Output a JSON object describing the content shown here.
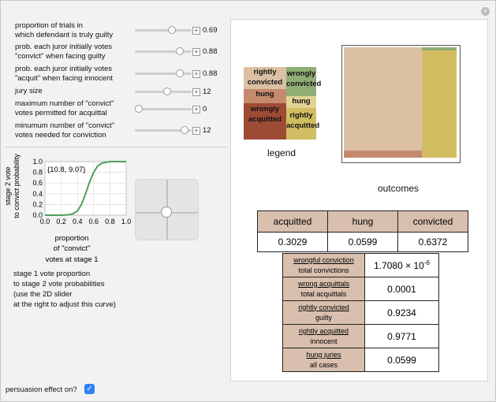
{
  "controls": [
    {
      "label_line1": "proportion of trials in",
      "label_line2": "which defendant is truly guilty",
      "value": "0.69",
      "fraction": 0.69
    },
    {
      "label_line1": "prob. each juror initially votes",
      "label_line2": "\"convict\" when facing guilty",
      "value": "0.88",
      "fraction": 0.88
    },
    {
      "label_line1": "prob. each juror initially votes",
      "label_line2": "\"acquit\" when facing innocent",
      "value": "0.88",
      "fraction": 0.88
    },
    {
      "label_line1": "jury size",
      "label_line2": "",
      "value": "12",
      "fraction": 0.55
    },
    {
      "label_line1": "maximum number of \"convict\"",
      "label_line2": "votes permitted for acquittal",
      "value": "0",
      "fraction": 0.0
    },
    {
      "label_line1": "minumum number of \"convict\"",
      "label_line2": "votes needed for conviction",
      "value": "12",
      "fraction": 1.0
    }
  ],
  "mini_plot": {
    "annotation": "{10.8, 9.07}",
    "ylabel_line1": "stage 2 vote",
    "ylabel_line2": "to convict probability",
    "xlabel_line1": "proportion",
    "xlabel_line2": "of \"convict\"",
    "xlabel_line3": "votes at stage 1",
    "ticks": [
      "0.0",
      "0.2",
      "0.4",
      "0.6",
      "0.8",
      "1.0"
    ]
  },
  "chart_data": {
    "type": "line",
    "x": [
      0.0,
      0.1,
      0.2,
      0.3,
      0.35,
      0.4,
      0.45,
      0.5,
      0.55,
      0.6,
      0.65,
      0.7,
      0.8,
      0.9,
      1.0
    ],
    "series": [
      {
        "values": [
          0.0,
          0.0,
          0.0,
          0.01,
          0.03,
          0.08,
          0.2,
          0.4,
          0.62,
          0.8,
          0.92,
          0.97,
          1.0,
          1.0,
          1.0
        ]
      }
    ],
    "xlim": [
      0,
      1
    ],
    "ylim": [
      0,
      1
    ],
    "grid": true,
    "color": "#4f9d5b"
  },
  "note": {
    "line1": "stage 1 vote proportion",
    "line2": "to stage 2 vote probabilities",
    "line3": "(use the 2D slider",
    "line4": "at the right to adjust this curve)"
  },
  "persuasion": {
    "label": "persuasion effect on?",
    "checked": true,
    "check_glyph": "✓"
  },
  "legend": {
    "title": "legend",
    "rightly_convicted_1": "rightly",
    "rightly_convicted_2": "convicted",
    "hung_left": "hung",
    "wrongly_acquitted_1": "wrongly",
    "wrongly_acquitted_2": "acquitted",
    "wrongly_convicted_1": "wrongly",
    "wrongly_convicted_2": "convicted",
    "hung_right": "hung",
    "rightly_acquitted_1": "rightly",
    "rightly_acquitted_2": "acquitted",
    "colors": {
      "rightly_convicted": "#dcc0a4",
      "hung_left": "#c48a6c",
      "wrongly_acquitted": "#9e4b36",
      "wrongly_convicted": "#8fae74",
      "hung_right": "#e2d395",
      "rightly_acquitted": "#d2bd63"
    }
  },
  "outcomes": {
    "title": "outcomes",
    "guilty_fraction": 0.69,
    "innocent_wrongly_convicted_fraction": 0.03
  },
  "table1": {
    "headers": [
      "acquitted",
      "hung",
      "convicted"
    ],
    "values": [
      "0.3029",
      "0.0599",
      "0.6372"
    ]
  },
  "table2": {
    "rows": [
      {
        "num": "wrongful conviction",
        "den": "total convictions",
        "value_mantissa": "1.7080 × 10",
        "value_exp": "-6"
      },
      {
        "num": "wrong acquittals",
        "den": "total acquittals",
        "value_mantissa": "0.0001",
        "value_exp": ""
      },
      {
        "num": "rightly convicted",
        "den": "guilty",
        "value_mantissa": "0.9234",
        "value_exp": ""
      },
      {
        "num": "rightly acquitted",
        "den": "innocent",
        "value_mantissa": "0.9771",
        "value_exp": ""
      },
      {
        "num": "hung juries",
        "den": "all cases",
        "value_mantissa": "0.0599",
        "value_exp": ""
      }
    ]
  }
}
